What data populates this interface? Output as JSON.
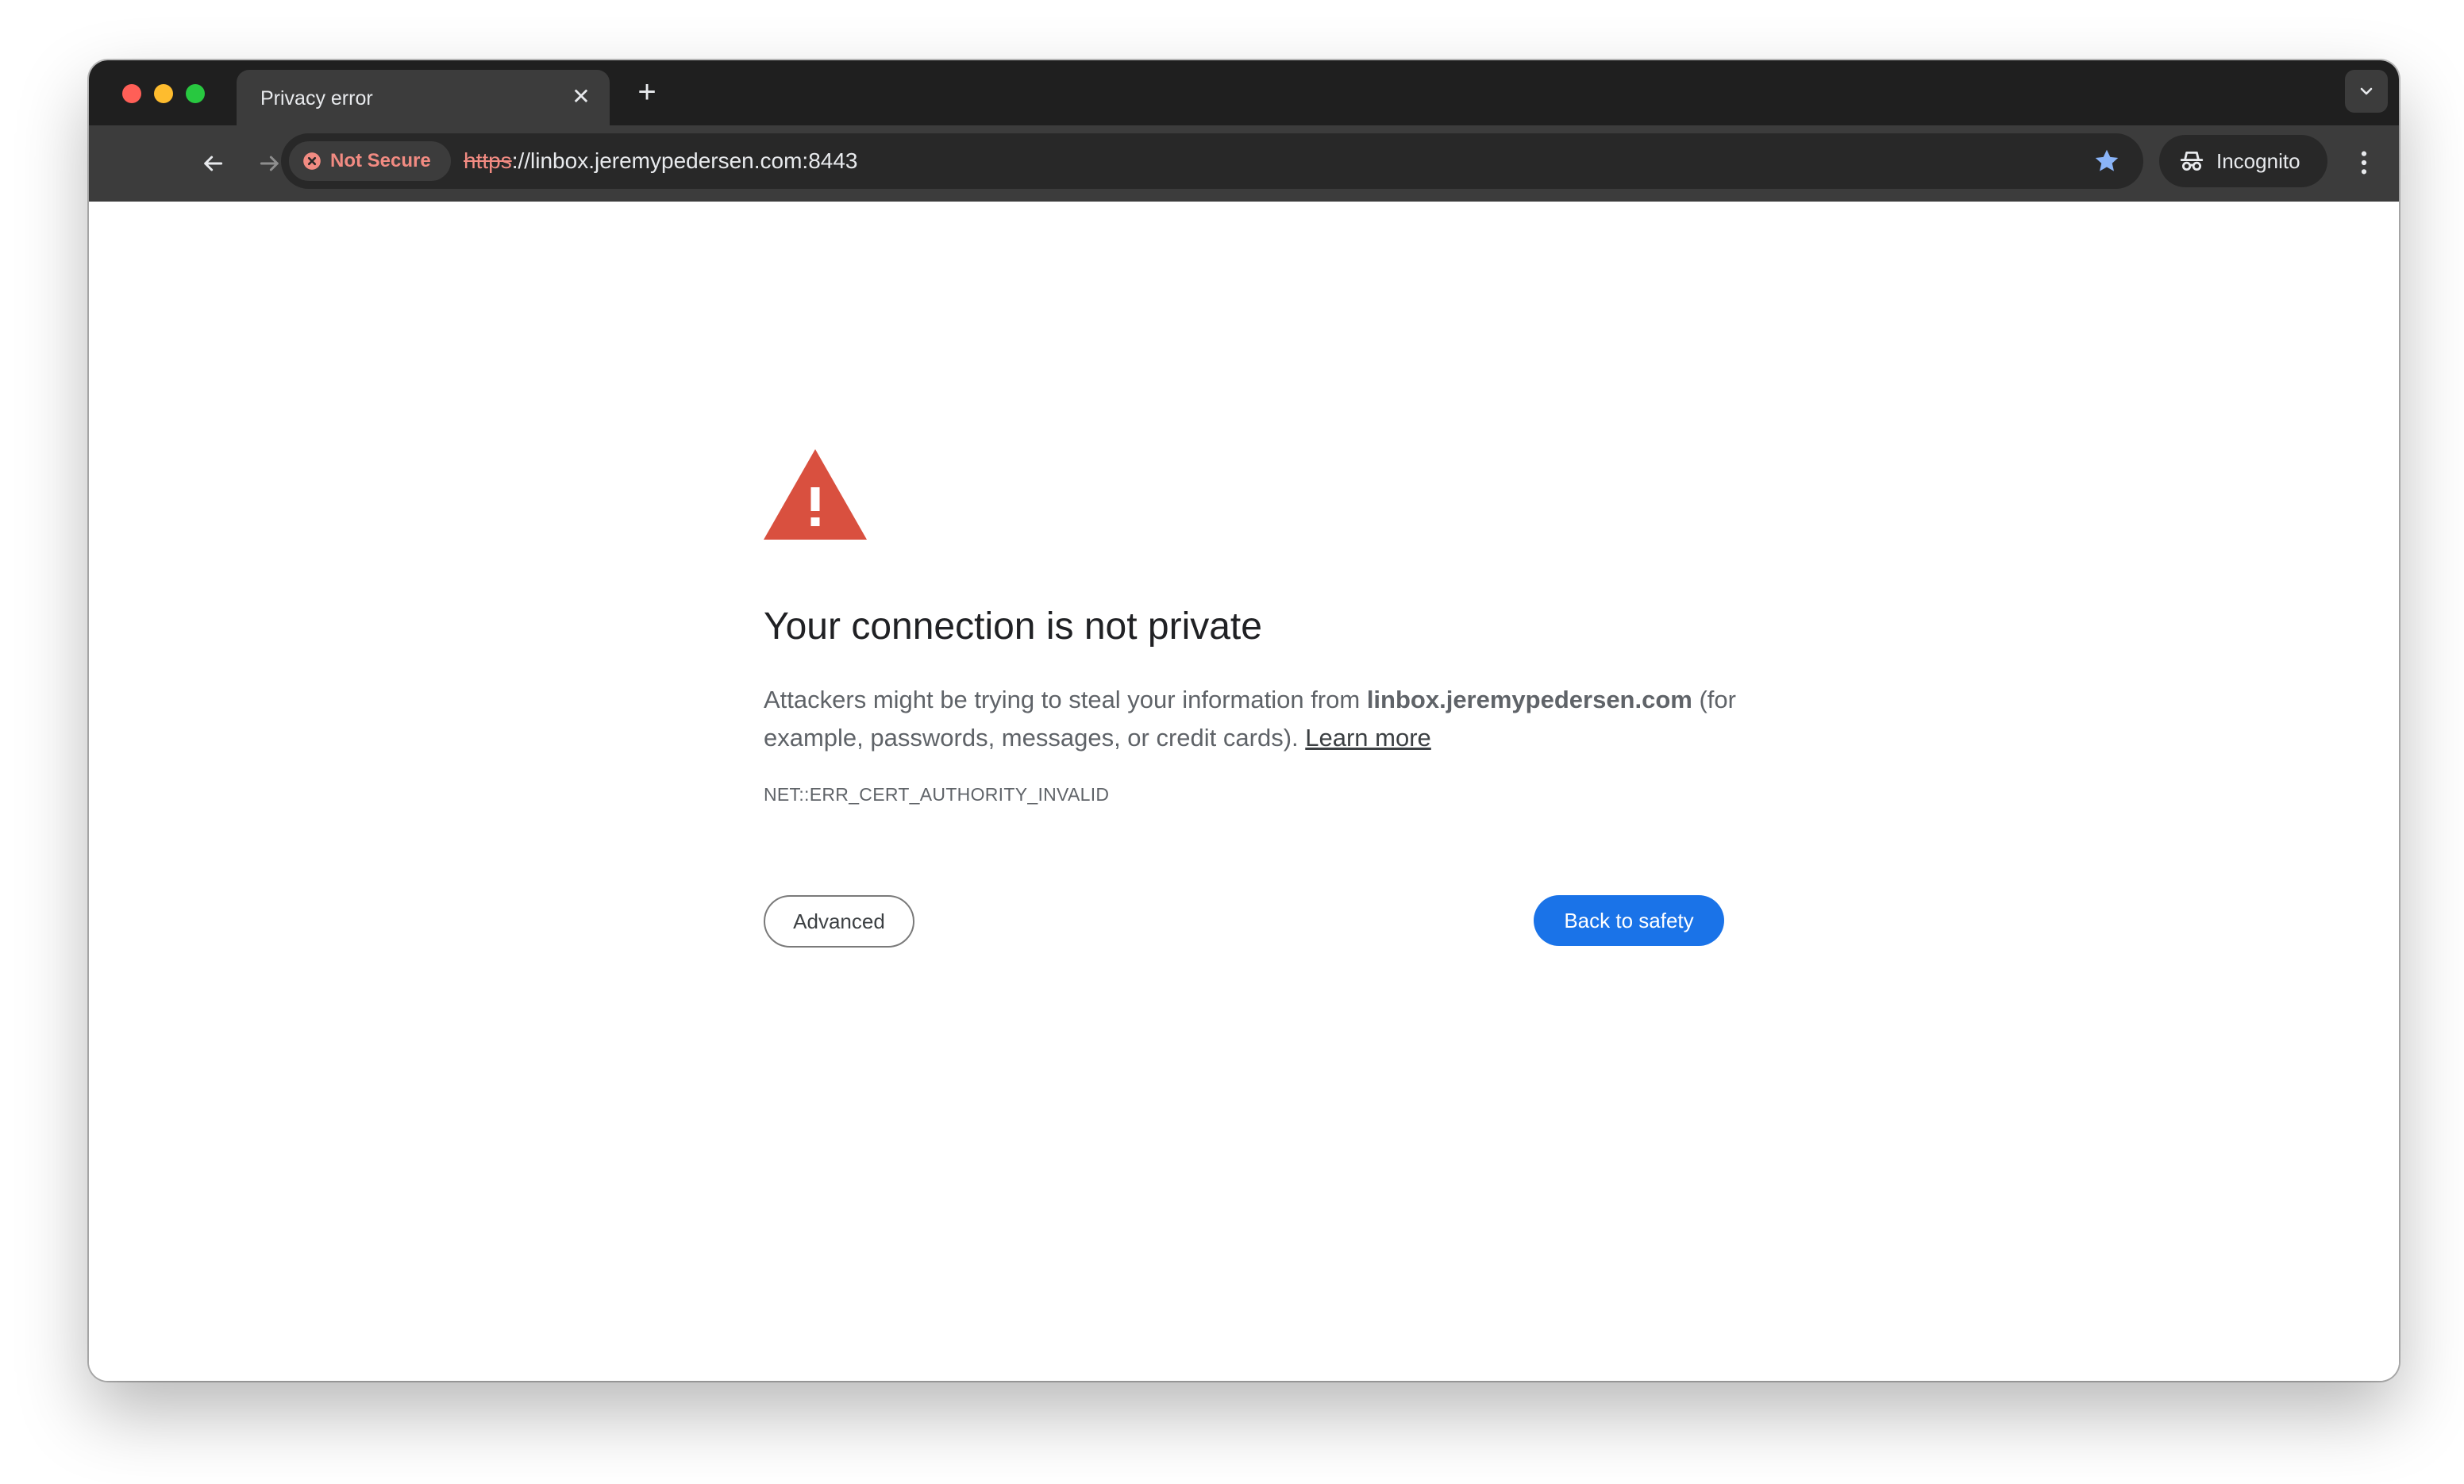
{
  "tab": {
    "title": "Privacy error",
    "close_glyph": "✕",
    "new_tab_glyph": "+"
  },
  "toolbar": {
    "security_chip_label": "Not Secure",
    "url_scheme": "https",
    "url_rest": "://linbox.jeremypedersen.com:8443",
    "incognito_label": "Incognito"
  },
  "page": {
    "heading": "Your connection is not private",
    "body_prefix": "Attackers might be trying to steal your information from ",
    "body_domain": "linbox.jeremypedersen.com",
    "body_suffix": " (for example, passwords, messages, or credit cards). ",
    "learn_more": "Learn more",
    "error_code": "NET::ERR_CERT_AUTHORITY_INVALID",
    "advanced_button": "Advanced",
    "back_button": "Back to safety"
  },
  "icons": {
    "back": "arrow-left-icon",
    "forward": "arrow-right-icon",
    "reload": "reload-icon",
    "not_secure": "x-circle-icon",
    "bookmark": "star-icon",
    "incognito": "incognito-icon",
    "menu": "kebab-menu-icon",
    "warning": "warning-triangle-icon",
    "tab_search": "chevron-down-icon"
  },
  "colors": {
    "titlebar": "#1f1f1f",
    "toolbar": "#3c3c3c",
    "warning_red": "#d9503f",
    "not_secure": "#f28b82",
    "primary_blue": "#1a73e8",
    "bookmark_star": "#8ab4f8"
  }
}
